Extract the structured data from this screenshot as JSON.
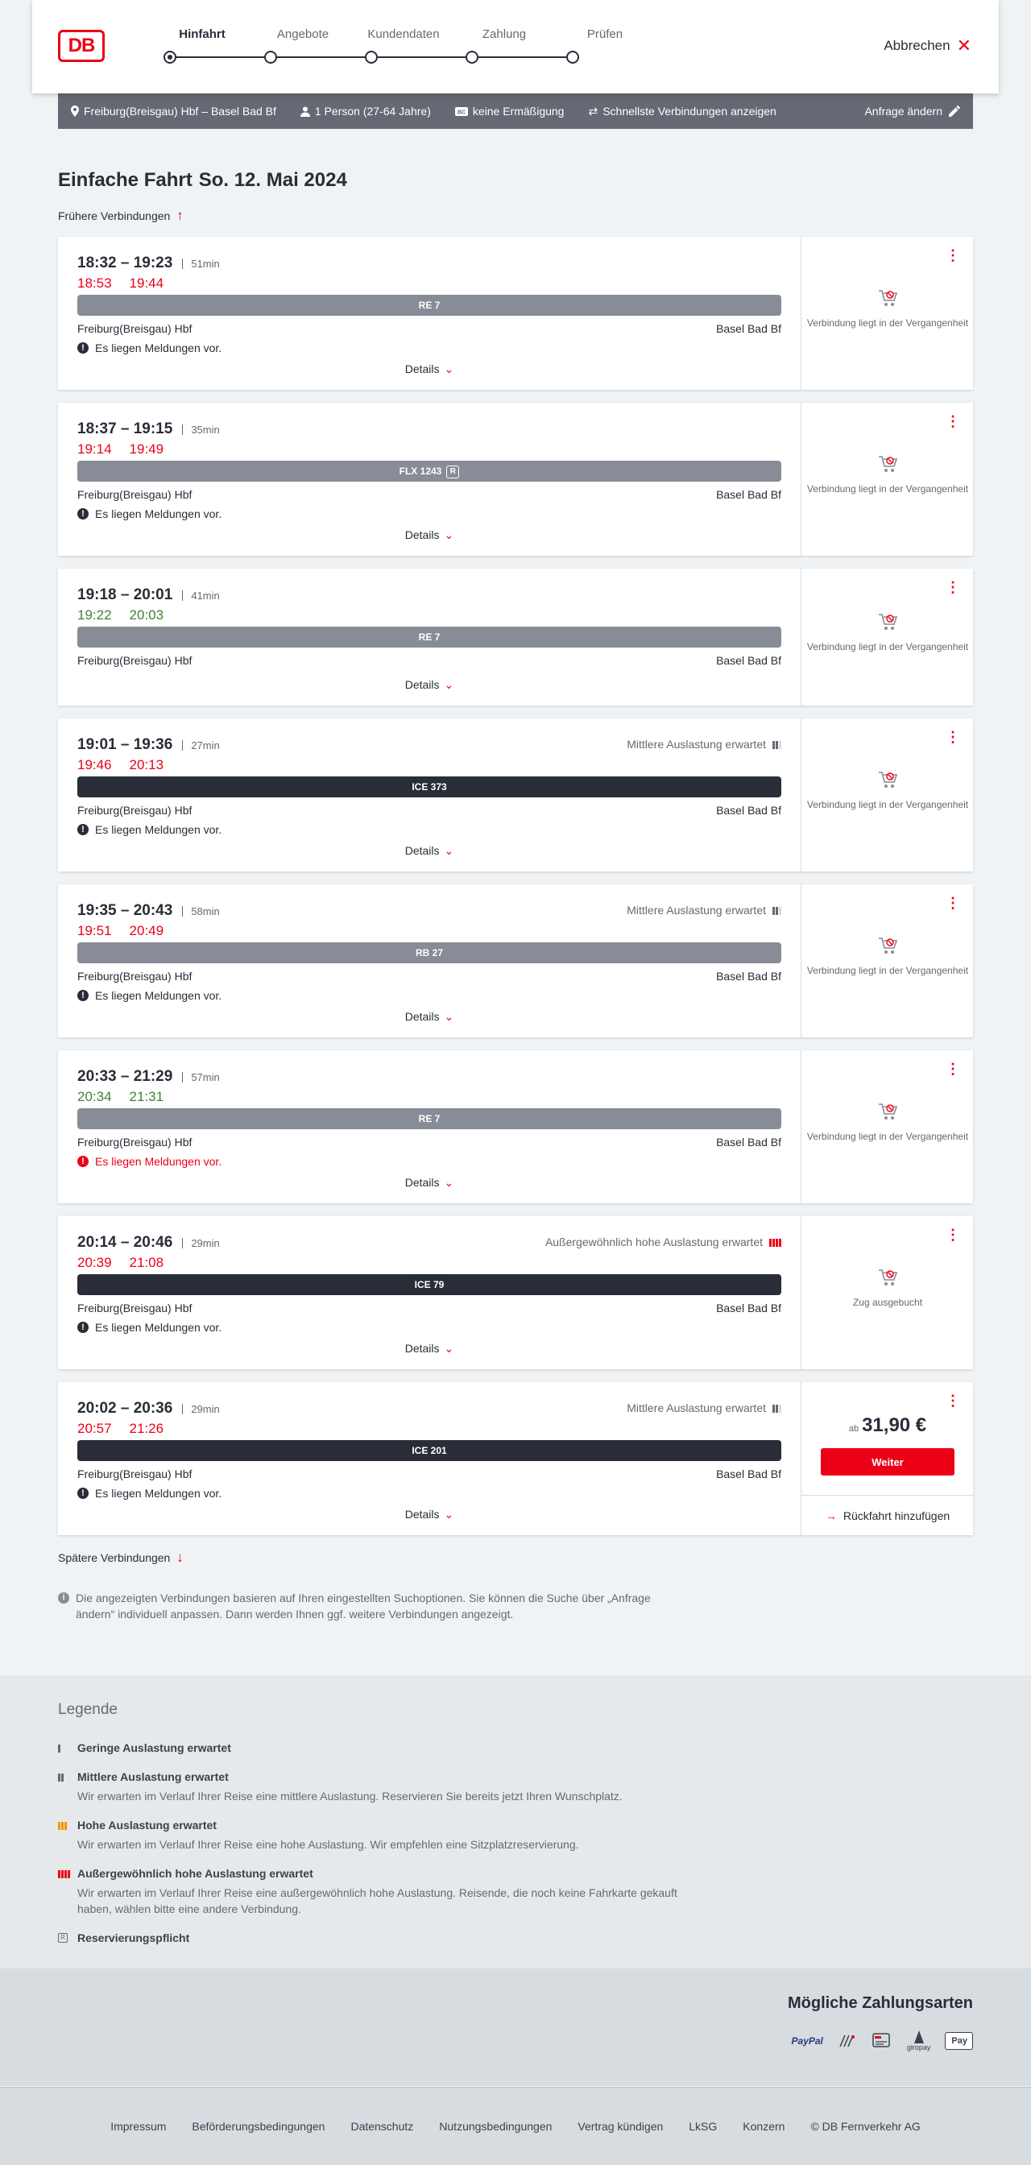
{
  "header": {
    "logo": "DB",
    "steps": [
      "Hinfahrt",
      "Angebote",
      "Kundendaten",
      "Zahlung",
      "Prüfen"
    ],
    "cancel": "Abbrechen"
  },
  "searchbar": {
    "route": "Freiburg(Breisgau) Hbf – Basel Bad Bf",
    "persons": "1 Person (27-64 Jahre)",
    "discount": "keine Ermäßigung",
    "fastest": "Schnellste Verbindungen anzeigen",
    "change": "Anfrage ändern"
  },
  "title": {
    "type": "Einfache Fahrt",
    "date": "So. 12. Mai 2024"
  },
  "earlier": "Frühere Verbindungen",
  "later": "Spätere Verbindungen",
  "connections": [
    {
      "time": "18:32 – 19:23",
      "duration": "51min",
      "rt_dep": "18:53",
      "rt_arr": "19:44",
      "rt_dep_color": "red",
      "rt_arr_color": "red",
      "train": "RE 7",
      "dark": false,
      "from": "Freiburg(Breisgau) Hbf",
      "to": "Basel Bad Bf",
      "message": "Es liegen Meldungen vor.",
      "alert": false,
      "details": "Details",
      "load": "",
      "status": "Verbindung liegt in der Vergangenheit"
    },
    {
      "time": "18:37 – 19:15",
      "duration": "35min",
      "rt_dep": "19:14",
      "rt_arr": "19:49",
      "rt_dep_color": "red",
      "rt_arr_color": "red",
      "train": "FLX 1243",
      "badge": "R",
      "dark": false,
      "from": "Freiburg(Breisgau) Hbf",
      "to": "Basel Bad Bf",
      "message": "Es liegen Meldungen vor.",
      "alert": false,
      "details": "Details",
      "load": "",
      "status": "Verbindung liegt in der Vergangenheit"
    },
    {
      "time": "19:18 – 20:01",
      "duration": "41min",
      "rt_dep": "19:22",
      "rt_arr": "20:03",
      "rt_dep_color": "green",
      "rt_arr_color": "green",
      "train": "RE 7",
      "dark": false,
      "from": "Freiburg(Breisgau) Hbf",
      "to": "Basel Bad Bf",
      "message": "",
      "alert": false,
      "details": "Details",
      "load": "",
      "status": "Verbindung liegt in der Vergangenheit"
    },
    {
      "time": "19:01 – 19:36",
      "duration": "27min",
      "rt_dep": "19:46",
      "rt_arr": "20:13",
      "rt_dep_color": "red",
      "rt_arr_color": "red",
      "train": "ICE 373",
      "dark": true,
      "from": "Freiburg(Breisgau) Hbf",
      "to": "Basel Bad Bf",
      "message": "Es liegen Meldungen vor.",
      "alert": false,
      "details": "Details",
      "load": "Mittlere Auslastung erwartet",
      "status": "Verbindung liegt in der Vergangenheit"
    },
    {
      "time": "19:35 – 20:43",
      "duration": "58min",
      "rt_dep": "19:51",
      "rt_arr": "20:49",
      "rt_dep_color": "red",
      "rt_arr_color": "red",
      "train": "RB 27",
      "dark": false,
      "from": "Freiburg(Breisgau) Hbf",
      "to": "Basel Bad Bf",
      "message": "Es liegen Meldungen vor.",
      "alert": false,
      "details": "Details",
      "load": "Mittlere Auslastung erwartet",
      "status": "Verbindung liegt in der Vergangenheit"
    },
    {
      "time": "20:33 – 21:29",
      "duration": "57min",
      "rt_dep": "20:34",
      "rt_arr": "21:31",
      "rt_dep_color": "green",
      "rt_arr_color": "green",
      "train": "RE 7",
      "dark": false,
      "from": "Freiburg(Breisgau) Hbf",
      "to": "Basel Bad Bf",
      "message": "Es liegen Meldungen vor.",
      "alert": true,
      "details": "Details",
      "load": "",
      "status": "Verbindung liegt in der Vergangenheit"
    },
    {
      "time": "20:14 – 20:46",
      "duration": "29min",
      "rt_dep": "20:39",
      "rt_arr": "21:08",
      "rt_dep_color": "red",
      "rt_arr_color": "red",
      "train": "ICE 79",
      "dark": true,
      "from": "Freiburg(Breisgau) Hbf",
      "to": "Basel Bad Bf",
      "message": "Es liegen Meldungen vor.",
      "alert": false,
      "details": "Details",
      "load": "Außergewöhnlich hohe Auslastung erwartet",
      "status": "Zug ausgebucht"
    },
    {
      "time": "20:02 – 20:36",
      "duration": "29min",
      "rt_dep": "20:57",
      "rt_arr": "21:26",
      "rt_dep_color": "red",
      "rt_arr_color": "red",
      "train": "ICE 201",
      "dark": true,
      "from": "Freiburg(Breisgau) Hbf",
      "to": "Basel Bad Bf",
      "message": "Es liegen Meldungen vor.",
      "alert": false,
      "details": "Details",
      "load": "Mittlere Auslastung erwartet",
      "status": "",
      "price_prefix": "ab",
      "price": "31,90 €",
      "book": "Weiter",
      "return": "Rückfahrt hinzufügen"
    }
  ],
  "info": "Die angezeigten Verbindungen basieren auf Ihren eingestellten Suchoptionen. Sie können die Suche über „Anfrage ändern“ individuell anpassen. Dann werden Ihnen ggf. weitere Verbindungen angezeigt.",
  "legend": {
    "title": "Legende",
    "items": [
      {
        "title": "Geringe Auslastung erwartet",
        "text": ""
      },
      {
        "title": "Mittlere Auslastung erwartet",
        "text": "Wir erwarten im Verlauf Ihrer Reise eine mittlere Auslastung. Reservieren Sie bereits jetzt Ihren Wunschplatz."
      },
      {
        "title": "Hohe Auslastung erwartet",
        "text": "Wir erwarten im Verlauf Ihrer Reise eine hohe Auslastung. Wir empfehlen eine Sitzplatzreservierung."
      },
      {
        "title": "Außergewöhnlich hohe Auslastung erwartet",
        "text": "Wir erwarten im Verlauf Ihrer Reise eine außergewöhnlich hohe Auslastung. Reisende, die noch keine Fahrkarte gekauft haben, wählen bitte eine andere Verbindung."
      },
      {
        "title": "Reservierungspflicht",
        "text": ""
      }
    ]
  },
  "payment": {
    "title": "Mögliche Zahlungsarten",
    "methods": [
      "PayPal",
      "Lastschrift",
      "Kreditkarte",
      "giropay",
      "Apple Pay"
    ],
    "paypal": "PayPal",
    "giropay": "giropay",
    "applepay": "Pay"
  },
  "footer": [
    "Impressum",
    "Beförderungsbedingungen",
    "Datenschutz",
    "Nutzungsbedingungen",
    "Vertrag kündigen",
    "LkSG",
    "Konzern",
    "© DB Fernverkehr AG"
  ],
  "colors": {
    "brand": "#ec0016",
    "delay": "#ec0016",
    "ontime": "#408335",
    "train_local": "#878c96",
    "train_long": "#282d37"
  }
}
